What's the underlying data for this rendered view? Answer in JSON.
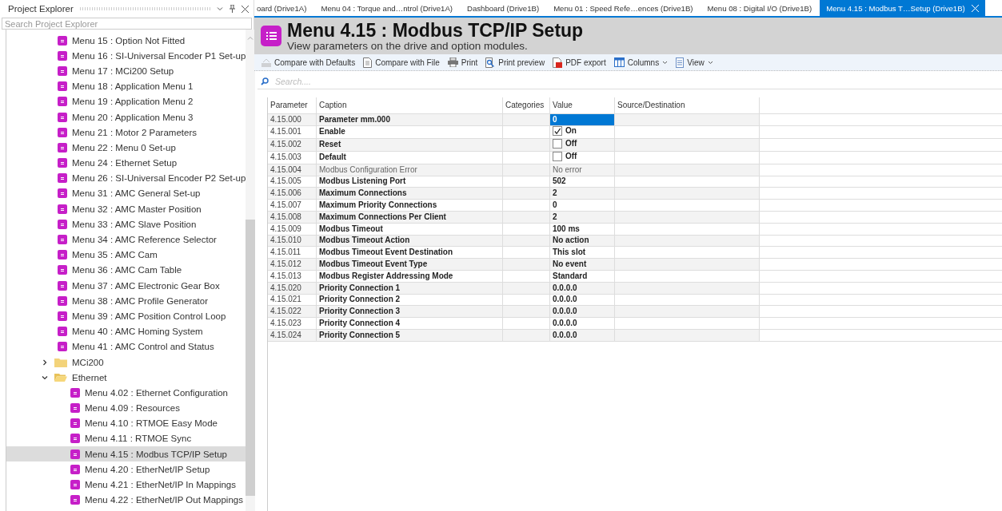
{
  "explorer": {
    "title": "Project Explorer",
    "search": {
      "placeholder": "Search Project Explorer"
    },
    "items": [
      {
        "kind": "menu",
        "label": "Menu 15 : Option Not Fitted",
        "selected": false
      },
      {
        "kind": "menu",
        "label": "Menu 16 : SI-Universal Encoder P1 Set-up",
        "selected": false
      },
      {
        "kind": "menu",
        "label": "Menu 17 : MCi200 Setup",
        "selected": false
      },
      {
        "kind": "menu",
        "label": "Menu 18 : Application Menu 1",
        "selected": false
      },
      {
        "kind": "menu",
        "label": "Menu 19 : Application Menu 2",
        "selected": false
      },
      {
        "kind": "menu",
        "label": "Menu 20 : Application Menu 3",
        "selected": false
      },
      {
        "kind": "menu",
        "label": "Menu 21 : Motor 2 Parameters",
        "selected": false
      },
      {
        "kind": "menu",
        "label": "Menu 22 : Menu 0 Set-up",
        "selected": false
      },
      {
        "kind": "menu",
        "label": "Menu 24 : Ethernet Setup",
        "selected": false
      },
      {
        "kind": "menu",
        "label": "Menu 26 : SI-Universal Encoder P2 Set-up",
        "selected": false
      },
      {
        "kind": "menu",
        "label": "Menu 31 : AMC General Set-up",
        "selected": false
      },
      {
        "kind": "menu",
        "label": "Menu 32 : AMC Master Position",
        "selected": false
      },
      {
        "kind": "menu",
        "label": "Menu 33 : AMC Slave Position",
        "selected": false
      },
      {
        "kind": "menu",
        "label": "Menu 34 : AMC Reference Selector",
        "selected": false
      },
      {
        "kind": "menu",
        "label": "Menu 35 : AMC Cam",
        "selected": false
      },
      {
        "kind": "menu",
        "label": "Menu 36 : AMC Cam Table",
        "selected": false
      },
      {
        "kind": "menu",
        "label": "Menu 37 : AMC Electronic Gear Box",
        "selected": false
      },
      {
        "kind": "menu",
        "label": "Menu 38 : AMC Profile Generator",
        "selected": false
      },
      {
        "kind": "menu",
        "label": "Menu 39 : AMC Position Control Loop",
        "selected": false
      },
      {
        "kind": "menu",
        "label": "Menu 40 : AMC Homing System",
        "selected": false
      },
      {
        "kind": "menu",
        "label": "Menu 41 : AMC Control and Status",
        "selected": false
      },
      {
        "kind": "folder",
        "label": "MCi200",
        "expanded": false,
        "selected": false
      },
      {
        "kind": "folder",
        "label": "Ethernet",
        "expanded": true,
        "selected": false,
        "children": [
          {
            "kind": "menu",
            "label": "Menu 4.02 : Ethernet Configuration",
            "selected": false
          },
          {
            "kind": "menu",
            "label": "Menu 4.09 : Resources",
            "selected": false
          },
          {
            "kind": "menu",
            "label": "Menu 4.10 : RTMOE Easy Mode",
            "selected": false
          },
          {
            "kind": "menu",
            "label": "Menu 4.11 : RTMOE Sync",
            "selected": false
          },
          {
            "kind": "menu",
            "label": "Menu 4.15 : Modbus TCP/IP Setup",
            "selected": true
          },
          {
            "kind": "menu",
            "label": "Menu 4.20 : EtherNet/IP Setup",
            "selected": false
          },
          {
            "kind": "menu",
            "label": "Menu 4.21 : EtherNet/IP In Mappings",
            "selected": false
          },
          {
            "kind": "menu",
            "label": "Menu 4.22 : EtherNet/IP Out Mappings",
            "selected": false
          }
        ]
      }
    ]
  },
  "tabs": [
    {
      "label": "oard (Drive1A)",
      "selected": false
    },
    {
      "label": "Menu 04 : Torque and…ntrol (Drive1A)",
      "selected": false
    },
    {
      "label": "Dashboard (Drive1B)",
      "selected": false
    },
    {
      "label": "Menu 01 : Speed Refe…ences (Drive1B)",
      "selected": false
    },
    {
      "label": "Menu 08 : Digital I/O (Drive1B)",
      "selected": false
    },
    {
      "label": "Menu 4.15 : Modbus T…Setup (Drive1B)",
      "selected": true
    }
  ],
  "header": {
    "title": "Menu 4.15 : Modbus TCP/IP Setup",
    "subtitle": "View parameters on the drive and option modules."
  },
  "toolbar": [
    {
      "kind": "compare",
      "label": "Compare with Defaults",
      "disabled": true
    },
    {
      "kind": "file",
      "label": "Compare with File",
      "disabled": false
    },
    {
      "kind": "print",
      "label": "Print",
      "disabled": false
    },
    {
      "kind": "preview",
      "label": "Print preview",
      "disabled": false
    },
    {
      "kind": "pdf",
      "label": "PDF export",
      "disabled": false
    },
    {
      "kind": "columns",
      "label": "Columns",
      "disabled": false,
      "dropdown": true
    },
    {
      "kind": "view",
      "label": "View",
      "disabled": false,
      "dropdown": true
    }
  ],
  "search": {
    "placeholder": "Search...."
  },
  "table": {
    "columns": [
      "Parameter",
      "Caption",
      "Categories",
      "Value",
      "Source/Destination"
    ],
    "rows": [
      {
        "parameter": "4.15.000",
        "caption": "Parameter mm.000",
        "kind": "text",
        "value": "0",
        "read_only": false,
        "selected": true
      },
      {
        "parameter": "4.15.001",
        "caption": "Enable",
        "kind": "checkbox",
        "checked": true,
        "value": "On",
        "read_only": false,
        "selected": false
      },
      {
        "parameter": "4.15.002",
        "caption": "Reset",
        "kind": "checkbox",
        "checked": false,
        "value": "Off",
        "read_only": false,
        "selected": false
      },
      {
        "parameter": "4.15.003",
        "caption": "Default",
        "kind": "checkbox",
        "checked": false,
        "value": "Off",
        "read_only": false,
        "selected": false
      },
      {
        "parameter": "4.15.004",
        "caption": "Modbus Configuration Error",
        "kind": "text",
        "value": "No error",
        "read_only": true,
        "selected": false
      },
      {
        "parameter": "4.15.005",
        "caption": "Modbus Listening Port",
        "kind": "text",
        "value": "502",
        "read_only": false,
        "selected": false
      },
      {
        "parameter": "4.15.006",
        "caption": "Maximum Connections",
        "kind": "text",
        "value": "2",
        "read_only": false,
        "selected": false
      },
      {
        "parameter": "4.15.007",
        "caption": "Maximum Priority Connections",
        "kind": "text",
        "value": "0",
        "read_only": false,
        "selected": false
      },
      {
        "parameter": "4.15.008",
        "caption": "Maximum Connections Per Client",
        "kind": "text",
        "value": "2",
        "read_only": false,
        "selected": false
      },
      {
        "parameter": "4.15.009",
        "caption": "Modbus Timeout",
        "kind": "text",
        "value": "100 ms",
        "read_only": false,
        "selected": false
      },
      {
        "parameter": "4.15.010",
        "caption": "Modbus Timeout Action",
        "kind": "text",
        "value": "No action",
        "read_only": false,
        "selected": false
      },
      {
        "parameter": "4.15.011",
        "caption": "Modbus Timeout Event Destination",
        "kind": "text",
        "value": "This slot",
        "read_only": false,
        "selected": false
      },
      {
        "parameter": "4.15.012",
        "caption": "Modbus Timeout Event Type",
        "kind": "text",
        "value": "No event",
        "read_only": false,
        "selected": false
      },
      {
        "parameter": "4.15.013",
        "caption": "Modbus Register Addressing Mode",
        "kind": "text",
        "value": "Standard",
        "read_only": false,
        "selected": false
      },
      {
        "parameter": "4.15.020",
        "caption": "Priority Connection 1",
        "kind": "text",
        "value": "0.0.0.0",
        "read_only": false,
        "selected": false
      },
      {
        "parameter": "4.15.021",
        "caption": "Priority Connection 2",
        "kind": "text",
        "value": "0.0.0.0",
        "read_only": false,
        "selected": false
      },
      {
        "parameter": "4.15.022",
        "caption": "Priority Connection 3",
        "kind": "text",
        "value": "0.0.0.0",
        "read_only": false,
        "selected": false
      },
      {
        "parameter": "4.15.023",
        "caption": "Priority Connection 4",
        "kind": "text",
        "value": "0.0.0.0",
        "read_only": false,
        "selected": false
      },
      {
        "parameter": "4.15.024",
        "caption": "Priority Connection 5",
        "kind": "text",
        "value": "0.0.0.0",
        "read_only": false,
        "selected": false
      }
    ]
  }
}
